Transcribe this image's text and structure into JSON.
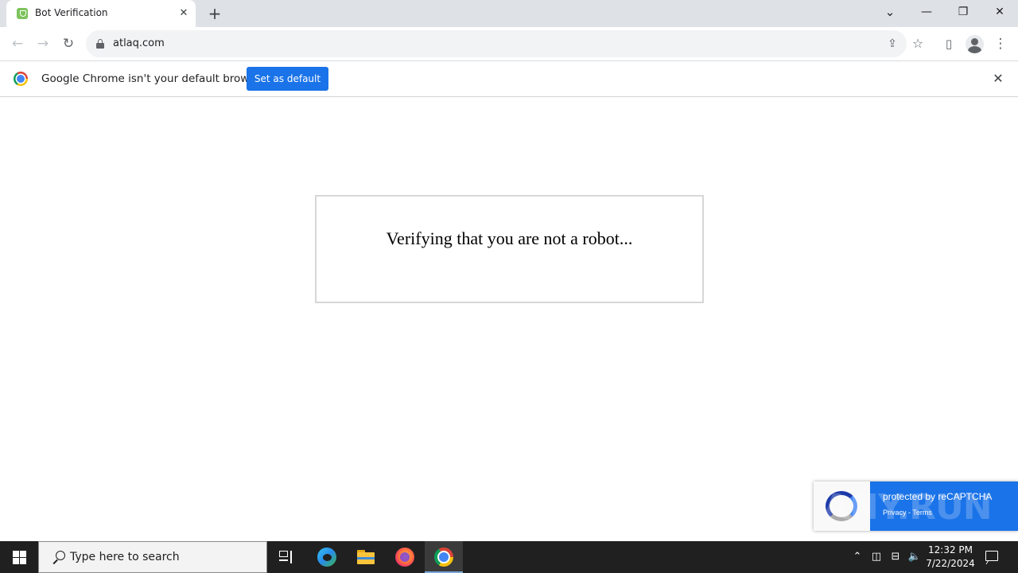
{
  "browser": {
    "tab": {
      "title": "Bot Verification",
      "close_glyph": "✕"
    },
    "new_tab_glyph": "+",
    "window_controls": {
      "tab_search": "⌄",
      "minimize": "—",
      "restore": "❐",
      "close": "✕"
    },
    "address_bar": {
      "url": "atlaq.com"
    },
    "nav": {
      "back": "←",
      "forward": "→",
      "reload": "↻"
    },
    "toolbar_icons": {
      "share": "⇪",
      "bookmark": "☆",
      "side_panel": "▯",
      "menu": "⋮"
    }
  },
  "infobar": {
    "message": "Google Chrome isn't your default browser",
    "button_label": "Set as default",
    "close_glyph": "✕"
  },
  "page": {
    "verify_text": "Verifying that you are not a robot..."
  },
  "recaptcha": {
    "title": "protected by reCAPTCHA",
    "links": "Privacy - Terms"
  },
  "watermark": {
    "text": "ANY.RUN"
  },
  "taskbar": {
    "search_placeholder": "Type here to search",
    "clock_time": "12:32 PM",
    "clock_date": "7/22/2024",
    "tray": {
      "chevron": "⌃",
      "meet": "◫",
      "network": "⊟",
      "volume": "🔈"
    }
  },
  "colors": {
    "tabstrip": "#dee1e6",
    "accent_blue": "#1a73e8",
    "taskbar": "#202020"
  }
}
